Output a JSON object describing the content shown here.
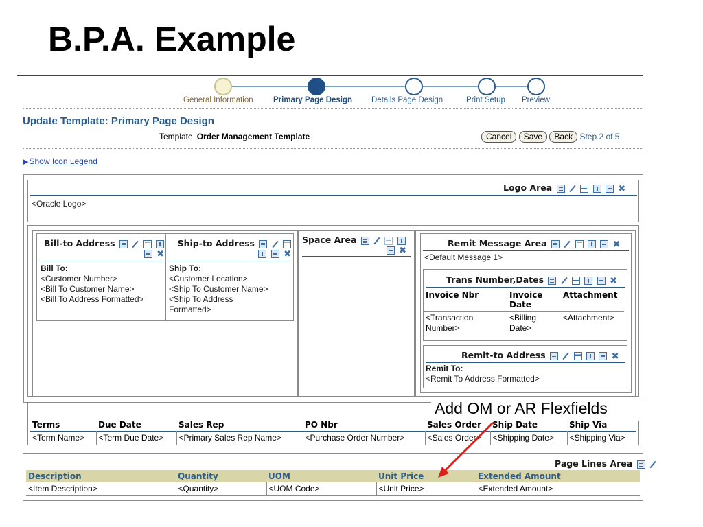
{
  "slide": {
    "title": "B.P.A. Example"
  },
  "train": {
    "steps": [
      {
        "label": "General Information",
        "state": "visited"
      },
      {
        "label": "Primary Page Design",
        "state": "current"
      },
      {
        "label": "Details Page Design",
        "state": "future"
      },
      {
        "label": "Print Setup",
        "state": "future"
      },
      {
        "label": "Preview",
        "state": "future"
      }
    ]
  },
  "page": {
    "heading": "Update Template: Primary Page Design",
    "template_label": "Template",
    "template_name": "Order Management Template",
    "buttons": {
      "cancel": "Cancel",
      "save": "Save",
      "back": "Back"
    },
    "step_indicator": "Step 2 of 5",
    "icon_legend_link": "Show Icon Legend"
  },
  "logo_area": {
    "title": "Logo Area",
    "content": "<Oracle Logo>"
  },
  "bill_to": {
    "title": "Bill-to Address",
    "lines": [
      "Bill To:",
      "<Customer Number>",
      "<Bill To Customer Name>",
      "<Bill To Address Formatted>"
    ]
  },
  "ship_to": {
    "title": "Ship-to Address",
    "lines": [
      "Ship To:",
      "<Customer Location>",
      "<Ship To Customer Name>",
      "<Ship To Address",
      "Formatted>"
    ]
  },
  "space_area": {
    "title": "Space Area"
  },
  "remit_message": {
    "title": "Remit Message Area",
    "content": "<Default Message 1>"
  },
  "trans_numbers": {
    "title": "Trans Number,Dates",
    "headers": [
      "Invoice Nbr",
      "Invoice Date",
      "Attachment"
    ],
    "values": [
      "<Transaction Number>",
      "<Billing Date>",
      "<Attachment>"
    ]
  },
  "remit_to": {
    "title": "Remit-to Address",
    "lines": [
      "Remit To:",
      "<Remit To Address Formatted>"
    ]
  },
  "header_table": {
    "columns": [
      "Terms",
      "Due Date",
      "Sales Rep",
      "PO Nbr",
      "Sales Order",
      "Ship Date",
      "Ship Via"
    ],
    "values": [
      "<Term Name>",
      "<Term Due Date>",
      "<Primary Sales Rep Name>",
      "<Purchase Order Number>",
      "<Sales Order>",
      "<Shipping Date>",
      "<Shipping Via>"
    ]
  },
  "lines_area": {
    "title": "Page Lines Area",
    "columns": [
      "Description",
      "Quantity",
      "UOM",
      "Unit Price",
      "Extended Amount"
    ],
    "values": [
      "<Item Description>",
      "<Quantity>",
      "<UOM Code>",
      "<Unit Price>",
      "<Extended Amount>"
    ]
  },
  "callout": {
    "text": "Add OM or AR Flexfields"
  },
  "colors": {
    "accent": "#2a5a88",
    "arrow": "#e0201b",
    "table_header_bg": "#d8d6a8"
  },
  "icons": [
    "properties-icon",
    "edit-icon",
    "split-icon",
    "add-below-icon",
    "add-right-icon",
    "delete-icon"
  ]
}
